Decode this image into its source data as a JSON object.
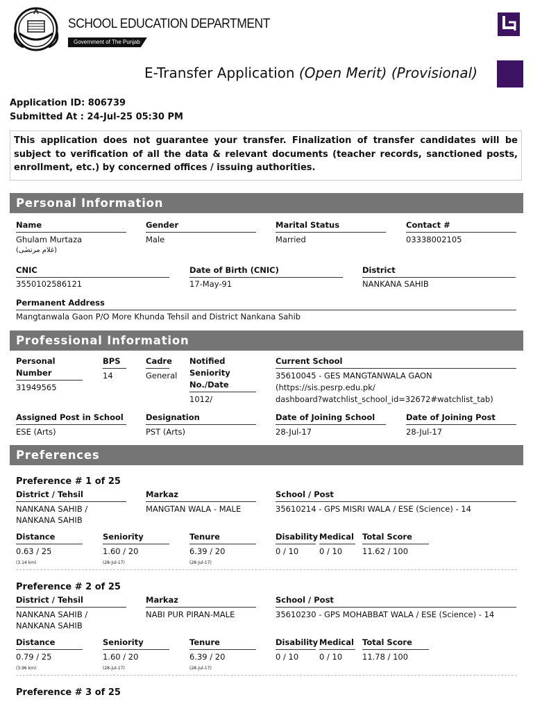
{
  "header": {
    "dept_title": "SCHOOL EDUCATION DEPARTMENT",
    "dept_sub": "Government of The Punjab",
    "app_title": "E-Transfer Application",
    "app_title_italic": "(Open Merit) (Provisional)"
  },
  "application": {
    "id_label": "Application ID: 806739",
    "submitted_label": "Submitted At : 24-Jul-25 05:30 PM",
    "notice": "This application does not guarantee your transfer. Finalization of transfer candidates will be subject to verification of all the data & relevant documents (teacher records, sanctioned posts, enrollment, etc.) by concerned offices / issuing authorities."
  },
  "personal": {
    "section_title": "Personal Information",
    "name_label": "Name",
    "name": "Ghulam Murtaza",
    "name_urdu": "(غلام مرتضٰی)",
    "gender_label": "Gender",
    "gender": "Male",
    "marital_label": "Marital Status",
    "marital": "Married",
    "contact_label": "Contact #",
    "contact": "03338002105",
    "cnic_label": "CNIC",
    "cnic": "3550102586121",
    "dob_label": "Date of Birth (CNIC)",
    "dob": "17-May-91",
    "district_label": "District",
    "district": "NANKANA SAHIB",
    "address_label": "Permanent Address",
    "address": "Mangtanwala Gaon P/O More Khunda Tehsil and District Nankana Sahib"
  },
  "professional": {
    "section_title": "Professional Information",
    "personal_number_label_1": "Personal",
    "personal_number_label_2": "Number",
    "personal_number": "31949565",
    "bps_label": "BPS",
    "bps": "14",
    "cadre_label": "Cadre",
    "cadre": "General",
    "seniority_label_1": "Notified",
    "seniority_label_2": "Seniority",
    "seniority_label_3": "No./Date",
    "seniority": "1012/",
    "school_label": "Current School",
    "school_line1": "35610045 - GES MANGTANWALA GAON",
    "school_line2": "(https://sis.pesrp.edu.pk/",
    "school_line3": "dashboard?watchlist_school_id=32672#watchlist_tab)",
    "assigned_post_label": "Assigned Post in School",
    "assigned_post": "ESE (Arts)",
    "designation_label": "Designation",
    "designation": "PST (Arts)",
    "doj_school_label": "Date of Joining School",
    "doj_school": "28-Jul-17",
    "doj_post_label": "Date of Joining Post",
    "doj_post": "28-Jul-17"
  },
  "preferences": {
    "section_title": "Preferences",
    "labels": {
      "district": "District / Tehsil",
      "markaz": "Markaz",
      "school": "School / Post",
      "distance": "Distance",
      "seniority": "Seniority",
      "tenure": "Tenure",
      "disability": "Disability",
      "medical": "Medical",
      "total": "Total Score"
    },
    "items": [
      {
        "heading": "Preference # 1 of 25",
        "district_line1": "NANKANA SAHIB /",
        "district_line2": "NANKANA SAHIB",
        "markaz": "MANGTAN WALA - MALE",
        "school": "35610214 - GPS MISRI WALA / ESE (Science) - 14",
        "distance": "0.63 / 25",
        "distance_sub": "(3.14 km)",
        "seniority": "1.60 / 20",
        "seniority_sub": "(28-Jul-17)",
        "tenure": "6.39 / 20",
        "tenure_sub": "(28-Jul-17)",
        "disability": "0 / 10",
        "medical": "0 / 10",
        "total": "11.62 / 100"
      },
      {
        "heading": "Preference # 2 of 25",
        "district_line1": "NANKANA SAHIB /",
        "district_line2": "NANKANA SAHIB",
        "markaz": "NABI PUR PIRAN-MALE",
        "school": "35610230 - GPS MOHABBAT WALA / ESE (Science) - 14",
        "distance": "0.79 / 25",
        "distance_sub": "(3.96 km)",
        "seniority": "1.60 / 20",
        "seniority_sub": "(28-Jul-17)",
        "tenure": "6.39 / 20",
        "tenure_sub": "(28-Jul-17)",
        "disability": "0 / 10",
        "medical": "0 / 10",
        "total": "11.78 / 100"
      },
      {
        "heading": "Preference # 3 of 25"
      }
    ]
  },
  "colors": {
    "section_bar": "#757575",
    "brand_purple": "#3d1263"
  }
}
